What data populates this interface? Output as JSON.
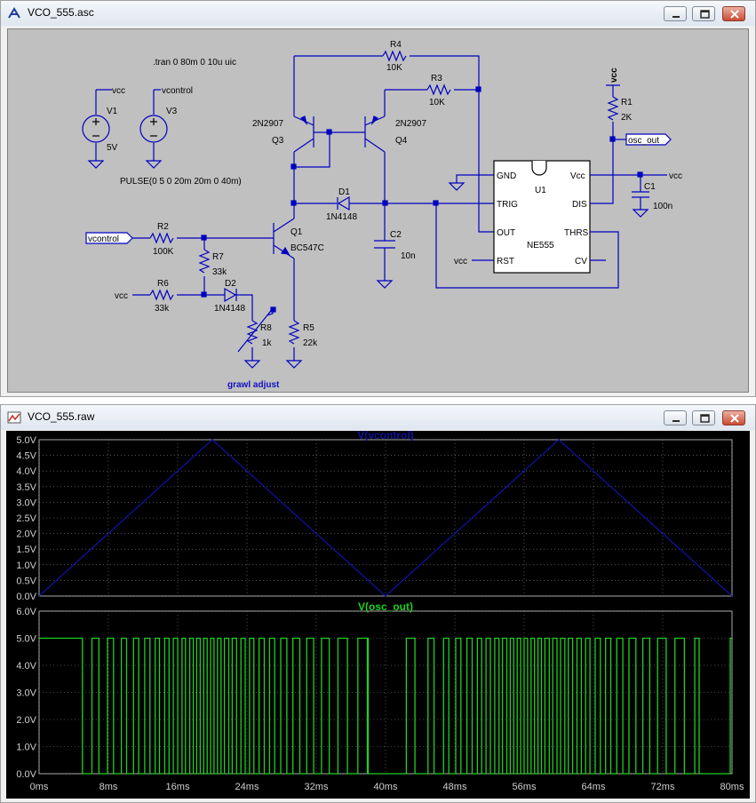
{
  "schematic_window": {
    "title": "VCO_555.asc",
    "directives": {
      "tran": ".tran 0 80m 0 10u uic",
      "pulse": "PULSE(0 5 0 20m 20m 0 40m)",
      "grawl": "grawl adjust"
    },
    "sources": {
      "v1_name": "V1",
      "v1_value": "5V",
      "v1_net": "vcc",
      "v3_name": "V3",
      "v3_net": "vcontrol"
    },
    "components": {
      "r4_name": "R4",
      "r4_value": "10K",
      "r3_name": "R3",
      "r3_value": "10K",
      "r1_name": "R1",
      "r1_value": "2K",
      "r2_name": "R2",
      "r2_value": "100K",
      "r7_name": "R7",
      "r7_value": "33k",
      "r6_name": "R6",
      "r6_value": "33k",
      "r8_name": "R8",
      "r8_value": "1k",
      "r5_name": "R5",
      "r5_value": "22k",
      "q3_name": "Q3",
      "q3_model": "2N2907",
      "q4_name": "Q4",
      "q4_model": "2N2907",
      "q1_name": "Q1",
      "q1_model": "BC547C",
      "d1_name": "D1",
      "d1_model": "1N4148",
      "d2_name": "D2",
      "d2_model": "1N4148",
      "c2_name": "C2",
      "c2_value": "10n",
      "c1_name": "C1",
      "c1_value": "100n",
      "u1_name": "U1",
      "u1_model": "NE555"
    },
    "ic_pins": {
      "gnd": "GND",
      "trig": "TRIG",
      "out": "OUT",
      "rst": "RST",
      "vcc": "Vcc",
      "dis": "DIS",
      "thrs": "THRS",
      "cv": "CV"
    },
    "nets": {
      "vcc_top": "vcc",
      "vcc_u1": "vcc",
      "vcc_rst": "vcc",
      "vcc_r6": "vcc",
      "vcontrol_port": "vcontrol",
      "osc_out_port": "osc_out"
    }
  },
  "waveform_window": {
    "title": "VCO_555.raw",
    "colors": {
      "plot_bg": "#000000",
      "grid": "#888888",
      "trace_top": "#1010a0",
      "trace_bottom": "#20d020"
    }
  },
  "chart_data": [
    {
      "type": "line",
      "title": "V(vcontrol)",
      "x_unit": "ms",
      "xlim": [
        0,
        80
      ],
      "ylim": [
        0,
        5
      ],
      "x_ticks": [
        "0ms",
        "8ms",
        "16ms",
        "24ms",
        "32ms",
        "40ms",
        "48ms",
        "56ms",
        "64ms",
        "72ms",
        "80ms"
      ],
      "y_ticks": [
        "0.0V",
        "0.5V",
        "1.0V",
        "1.5V",
        "2.0V",
        "2.5V",
        "3.0V",
        "3.5V",
        "4.0V",
        "4.5V",
        "5.0V"
      ],
      "series": [
        {
          "name": "V(vcontrol)",
          "x": [
            0,
            20,
            40,
            60,
            80
          ],
          "y": [
            0,
            5,
            0,
            5,
            0
          ]
        }
      ]
    },
    {
      "type": "line",
      "title": "V(osc_out)",
      "x_unit": "ms",
      "xlim": [
        0,
        80
      ],
      "ylim": [
        0,
        6
      ],
      "x_ticks": [
        "0ms",
        "8ms",
        "16ms",
        "24ms",
        "32ms",
        "40ms",
        "48ms",
        "56ms",
        "64ms",
        "72ms",
        "80ms"
      ],
      "y_ticks": [
        "0.0V",
        "1.0V",
        "2.0V",
        "3.0V",
        "4.0V",
        "5.0V",
        "6.0V"
      ],
      "high_level": 5,
      "low_level": 0,
      "low_intervals_ms": [
        [
          5.0,
          6.1
        ],
        [
          6.9,
          7.9
        ],
        [
          8.6,
          9.5
        ],
        [
          10.1,
          10.9
        ],
        [
          11.5,
          12.2
        ],
        [
          12.8,
          13.4
        ],
        [
          13.9,
          14.5
        ],
        [
          15.0,
          15.5
        ],
        [
          16.0,
          16.5
        ],
        [
          16.9,
          17.4
        ],
        [
          17.8,
          18.2
        ],
        [
          18.6,
          19.0
        ],
        [
          19.4,
          19.8
        ],
        [
          20.2,
          20.6
        ],
        [
          21.0,
          21.4
        ],
        [
          21.9,
          22.3
        ],
        [
          22.8,
          23.3
        ],
        [
          23.8,
          24.3
        ],
        [
          24.8,
          25.4
        ],
        [
          26.0,
          26.6
        ],
        [
          27.2,
          27.9
        ],
        [
          28.6,
          29.3
        ],
        [
          30.1,
          30.9
        ],
        [
          31.7,
          32.6
        ],
        [
          33.5,
          34.5
        ],
        [
          35.6,
          36.8
        ],
        [
          37.9,
          37.9
        ],
        [
          38.0,
          42.4
        ],
        [
          43.4,
          44.9
        ],
        [
          45.6,
          46.7
        ],
        [
          47.3,
          48.1
        ],
        [
          48.7,
          49.4
        ],
        [
          50.0,
          50.6
        ],
        [
          51.1,
          51.6
        ],
        [
          52.1,
          52.6
        ],
        [
          53.1,
          53.5
        ],
        [
          54.0,
          54.4
        ],
        [
          54.8,
          55.2
        ],
        [
          55.6,
          56.0
        ],
        [
          56.4,
          56.8
        ],
        [
          57.2,
          57.6
        ],
        [
          58.0,
          58.4
        ],
        [
          58.9,
          59.3
        ],
        [
          59.8,
          60.2
        ],
        [
          60.7,
          61.1
        ],
        [
          61.6,
          62.1
        ],
        [
          62.6,
          63.1
        ],
        [
          63.6,
          64.2
        ],
        [
          64.8,
          65.4
        ],
        [
          66.0,
          66.7
        ],
        [
          67.4,
          68.1
        ],
        [
          68.9,
          69.7
        ],
        [
          70.5,
          71.4
        ],
        [
          72.4,
          73.4
        ],
        [
          74.5,
          75.7
        ],
        [
          76.2,
          79.8
        ]
      ]
    }
  ]
}
